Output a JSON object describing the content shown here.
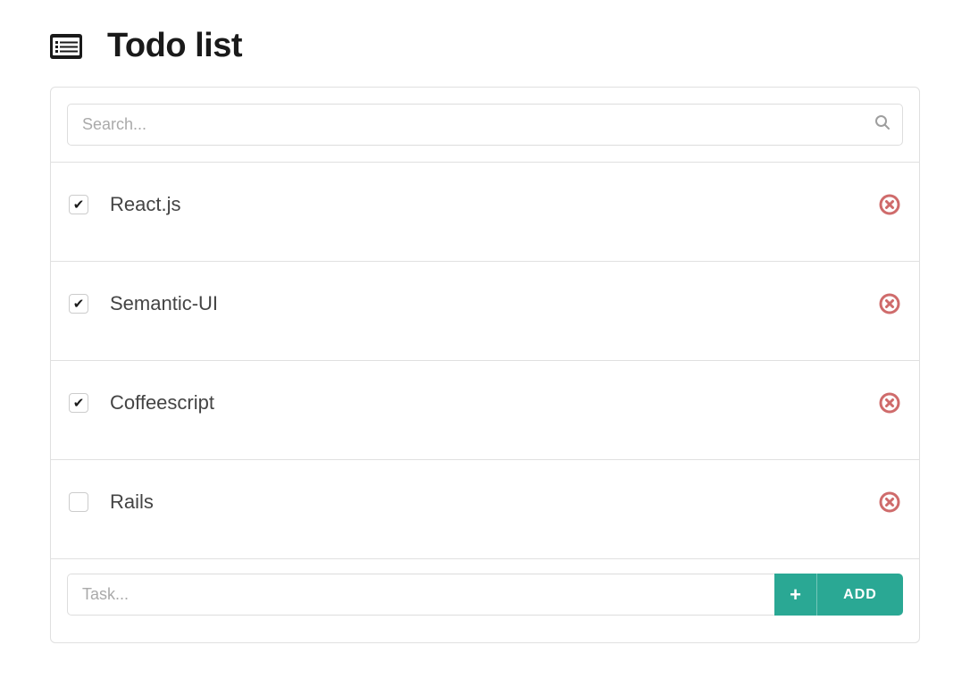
{
  "header": {
    "title": "Todo list"
  },
  "search": {
    "placeholder": "Search...",
    "value": ""
  },
  "todos": [
    {
      "label": "React.js",
      "checked": true
    },
    {
      "label": "Semantic-UI",
      "checked": true
    },
    {
      "label": "Coffeescript",
      "checked": true
    },
    {
      "label": "Rails",
      "checked": false
    }
  ],
  "addBar": {
    "placeholder": "Task...",
    "value": "",
    "buttonLabel": "ADD"
  }
}
